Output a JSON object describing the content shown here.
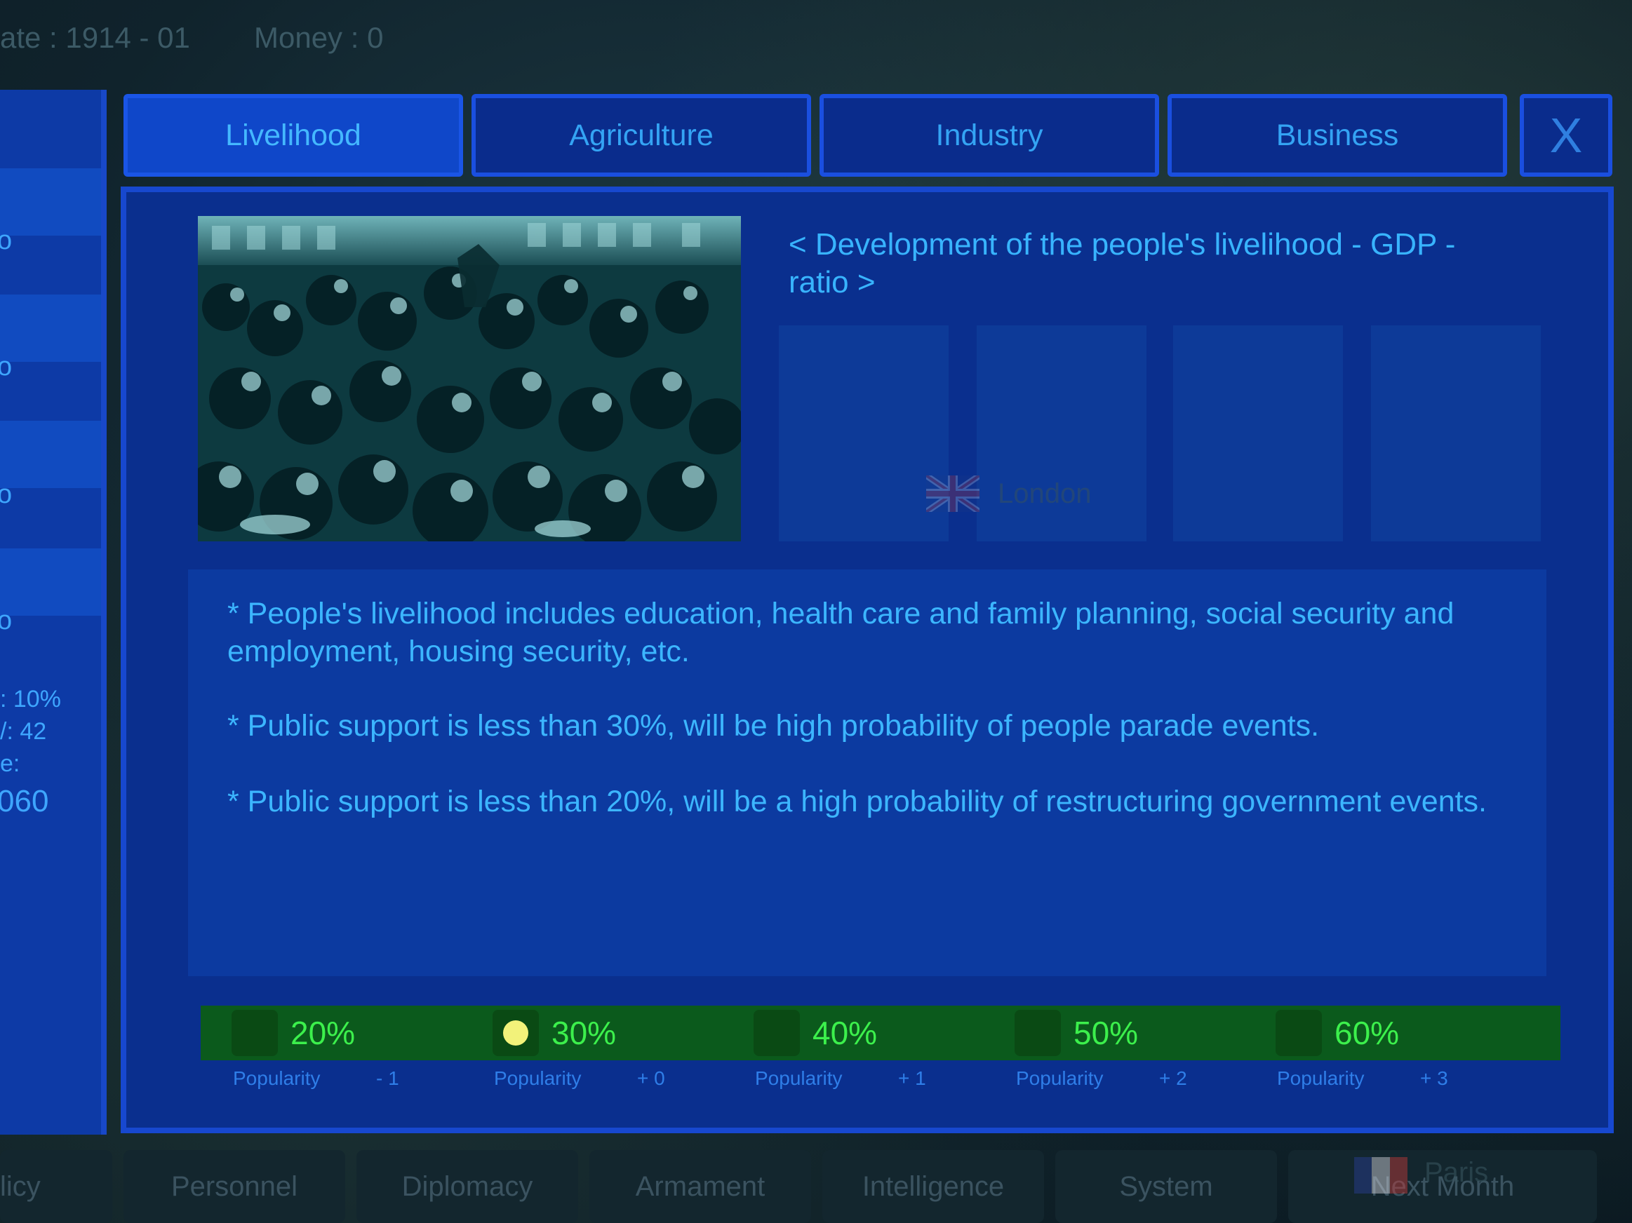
{
  "topbar": {
    "date": "ate : 1914 - 01",
    "money": "Money : 0"
  },
  "left_panel": {
    "row_pcts": [
      "o",
      "o",
      "o",
      "o"
    ],
    "stats": [
      ": 10%",
      "/: 42",
      "e:"
    ],
    "big_value": "060"
  },
  "tabs": [
    {
      "label": "Livelihood",
      "active": true
    },
    {
      "label": "Agriculture",
      "active": false
    },
    {
      "label": "Industry",
      "active": false
    },
    {
      "label": "Business",
      "active": false
    }
  ],
  "close_label": "X",
  "panel": {
    "heading": "< Development of the people's livelihood - GDP - ratio >",
    "descriptions": [
      "* People's livelihood includes education, health care and family planning, social security and employment, housing security, etc.",
      "* Public support is less than 30%, will be high probability of people parade events.",
      "* Public support is less than 20%, will be a high probability of restructuring government events."
    ]
  },
  "options": [
    {
      "pct": "20%",
      "label": "Popularity",
      "mod": "- 1",
      "selected": false
    },
    {
      "pct": "30%",
      "label": "Popularity",
      "mod": "+ 0",
      "selected": true
    },
    {
      "pct": "40%",
      "label": "Popularity",
      "mod": "+ 1",
      "selected": false
    },
    {
      "pct": "50%",
      "label": "Popularity",
      "mod": "+ 2",
      "selected": false
    },
    {
      "pct": "60%",
      "label": "Popularity",
      "mod": "+ 3",
      "selected": false
    }
  ],
  "bottom_menu": [
    "licy",
    "Personnel",
    "Diplomacy",
    "Armament",
    "Intelligence",
    "System",
    "Next Month"
  ],
  "map_labels": {
    "london": "London",
    "paris": "Paris"
  },
  "colors": {
    "accent": "#1a4fe0",
    "text": "#38b4ff",
    "green": "#3cf04c"
  }
}
